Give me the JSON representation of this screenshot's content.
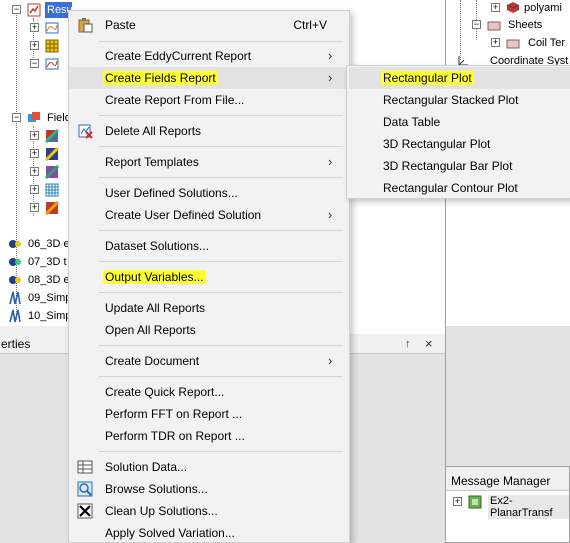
{
  "left_tree": {
    "results_label": "Results",
    "fields_label": "Field",
    "designs": [
      "06_3D e",
      "07_3D t",
      "08_3D e",
      "09_Simp",
      "10_Simp"
    ]
  },
  "properties_panel": {
    "title": "erties",
    "pin": "↑",
    "close": "×"
  },
  "right_tree": {
    "items": [
      "polyami",
      "Sheets",
      "Coil Ter",
      "Coordinate Syst"
    ]
  },
  "message_manager": {
    "title": "Message Manager",
    "project": "Ex2-PlanarTransf"
  },
  "context_menu": {
    "items": [
      {
        "label": "Paste",
        "shortcut": "Ctrl+V",
        "icon": "paste-icon"
      },
      {
        "label": "Create EddyCurrent Report",
        "submenu": true
      },
      {
        "label": "Create Fields Report",
        "submenu": true,
        "highlighted": true
      },
      {
        "label": "Create Report From File..."
      },
      {
        "label": "Delete All Reports",
        "icon": "delete-reports-icon"
      },
      {
        "label": "Report Templates",
        "submenu": true
      },
      {
        "label": "User Defined Solutions..."
      },
      {
        "label": "Create User Defined Solution",
        "submenu": true
      },
      {
        "label": "Dataset Solutions..."
      },
      {
        "label": "Output Variables..."
      },
      {
        "label": "Update All Reports"
      },
      {
        "label": "Open All Reports"
      },
      {
        "label": "Create Document",
        "submenu": true
      },
      {
        "label": "Create Quick Report..."
      },
      {
        "label": "Perform FFT on Report ..."
      },
      {
        "label": "Perform TDR on Report ..."
      },
      {
        "label": "Solution Data...",
        "icon": "solution-data-icon"
      },
      {
        "label": "Browse Solutions...",
        "icon": "browse-solutions-icon"
      },
      {
        "label": "Clean Up Solutions...",
        "icon": "clean-up-icon"
      },
      {
        "label": "Apply Solved Variation..."
      }
    ],
    "submenu_arrow": "›"
  },
  "fields_submenu": {
    "items": [
      {
        "label": "Rectangular Plot",
        "highlighted": true
      },
      {
        "label": "Rectangular Stacked Plot"
      },
      {
        "label": "Data Table"
      },
      {
        "label": "3D Rectangular Plot"
      },
      {
        "label": "3D Rectangular Bar Plot"
      },
      {
        "label": "Rectangular Contour Plot"
      }
    ]
  },
  "colors": {
    "highlight_yellow": "#ffff33",
    "menu_bg": "#f2f2f2",
    "tree_selection": "#3a6fd8"
  }
}
